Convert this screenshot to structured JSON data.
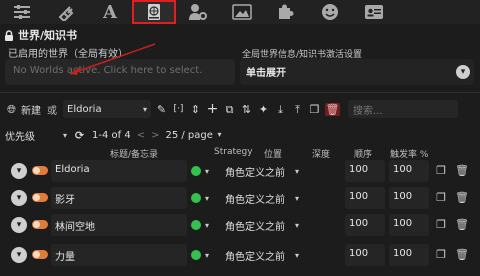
{
  "topbar": {
    "icons": [
      "sliders-icon",
      "plug-icon",
      "font-icon",
      "book-globe-icon",
      "users-cog-icon",
      "image-icon",
      "extensions-icon",
      "smiley-icon",
      "id-card-icon"
    ],
    "font_glyph": "A"
  },
  "header": {
    "title": "世界/知识书",
    "active_worlds_label": "已启用的世界（全局有效）",
    "worlds_placeholder": "No Worlds active. Click here to select.",
    "global_settings_label": "全局世界信息/知识书激活设置",
    "expand_label": "单击展开"
  },
  "toolbar": {
    "new_label": "新建",
    "or_label": "或",
    "selected_world": "Eldoria",
    "search_placeholder": "搜索..."
  },
  "sort": {
    "sort_value": "优先级",
    "page_info": "1-4 of 4",
    "prev": "<",
    "next": ">",
    "per_page": "25 / page"
  },
  "columns": {
    "title": "标题/备忘录",
    "strategy": "Strategy",
    "position": "位置",
    "depth": "深度",
    "order": "顺序",
    "trigger": "触发率 %"
  },
  "entries": [
    {
      "title": "Eldoria",
      "position": "角色定义之前",
      "order": "100",
      "trigger": "100"
    },
    {
      "title": "影牙",
      "position": "角色定义之前",
      "order": "100",
      "trigger": "100"
    },
    {
      "title": "林间空地",
      "position": "角色定义之前",
      "order": "100",
      "trigger": "100"
    },
    {
      "title": "力量",
      "position": "角色定义之前",
      "order": "100",
      "trigger": "100"
    }
  ],
  "colors": {
    "accent_orange": "#e07b39",
    "strategy_green": "#33c24d",
    "active_tab_border": "#e02020"
  }
}
